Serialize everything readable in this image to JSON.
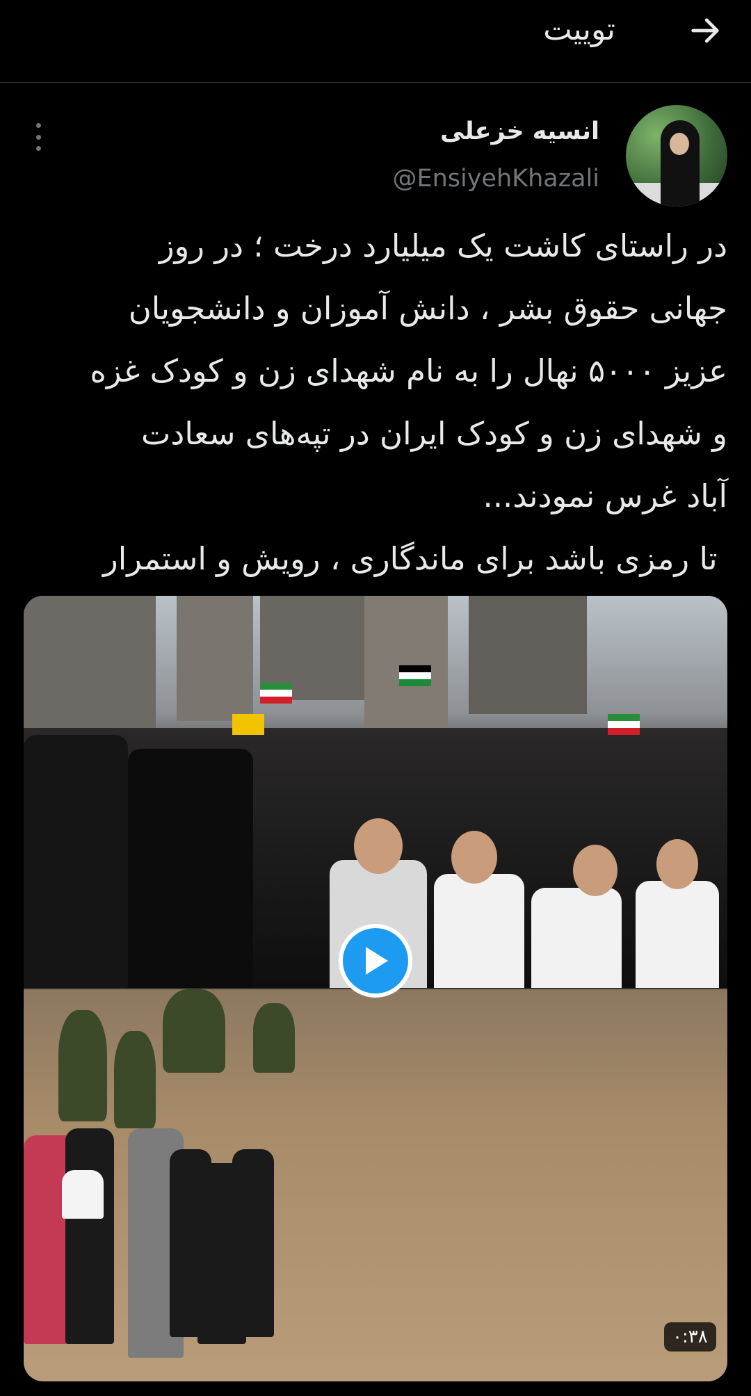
{
  "header": {
    "title": "توییت",
    "back_icon": "arrow-right-icon"
  },
  "tweet": {
    "display_name": "انسیه خزعلی",
    "handle": "@EnsiyehKhazali",
    "text": "در راستای کاشت یک میلیارد درخت ؛ در روز\nجهانی حقوق بشر ، دانش آموزان و دانشجویان\nعزیز ۵۰۰۰ نهال را به نام شهدای زن و کودک غزه\nو شهدای زن و کودک ایران در تپه‌های سعادت\nآباد غرس نمودند...\n تا رمزی باشد برای ماندگاری ، رویش و استمرار\nراه و رسم ایثار و شهادت.",
    "more_icon": "more-vertical-icon"
  },
  "media": {
    "duration": "۰:۳۸",
    "play_icon": "play-icon",
    "accent_color": "#1d9bf0"
  }
}
